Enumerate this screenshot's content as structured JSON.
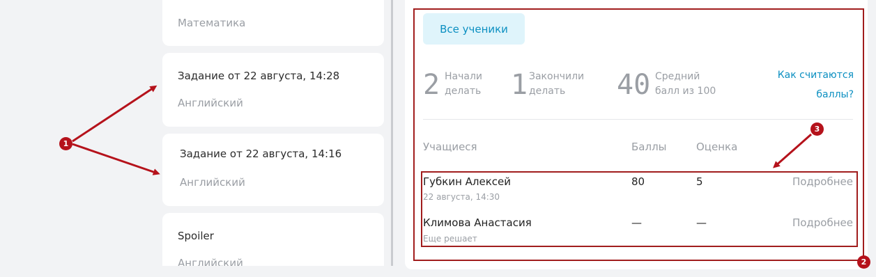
{
  "tasks": [
    {
      "title": "",
      "subject": "Математика"
    },
    {
      "title": "Задание от 22 августа, 14:28",
      "subject": "Английский"
    },
    {
      "title": "Задание от 22 августа, 14:16",
      "subject": "Английский"
    },
    {
      "title": "Spoiler",
      "subject": "Английский"
    }
  ],
  "results": {
    "all_students_button": "Все ученики",
    "stats": [
      {
        "value": "2",
        "label_line1": "Начали",
        "label_line2": "делать"
      },
      {
        "value": "1",
        "label_line1": "Закончили",
        "label_line2": "делать"
      },
      {
        "value": "40",
        "label_line1": "Средний",
        "label_line2": "балл из 100"
      }
    ],
    "how_link_line1": "Как считаются",
    "how_link_line2": "баллы?",
    "columns": {
      "students": "Учащиеся",
      "score": "Баллы",
      "grade": "Оценка"
    },
    "rows": [
      {
        "name": "Губкин Алексей",
        "sub": "22 августа, 14:30",
        "score": "80",
        "grade": "5",
        "details": "Подробнее"
      },
      {
        "name": "Климова Анастасия",
        "sub": "Еще решает",
        "score": "—",
        "grade": "—",
        "details": "Подробнее"
      }
    ]
  },
  "annotations": {
    "badge1": "1",
    "badge2": "2",
    "badge3": "3",
    "arrow_color": "#b5121b"
  }
}
